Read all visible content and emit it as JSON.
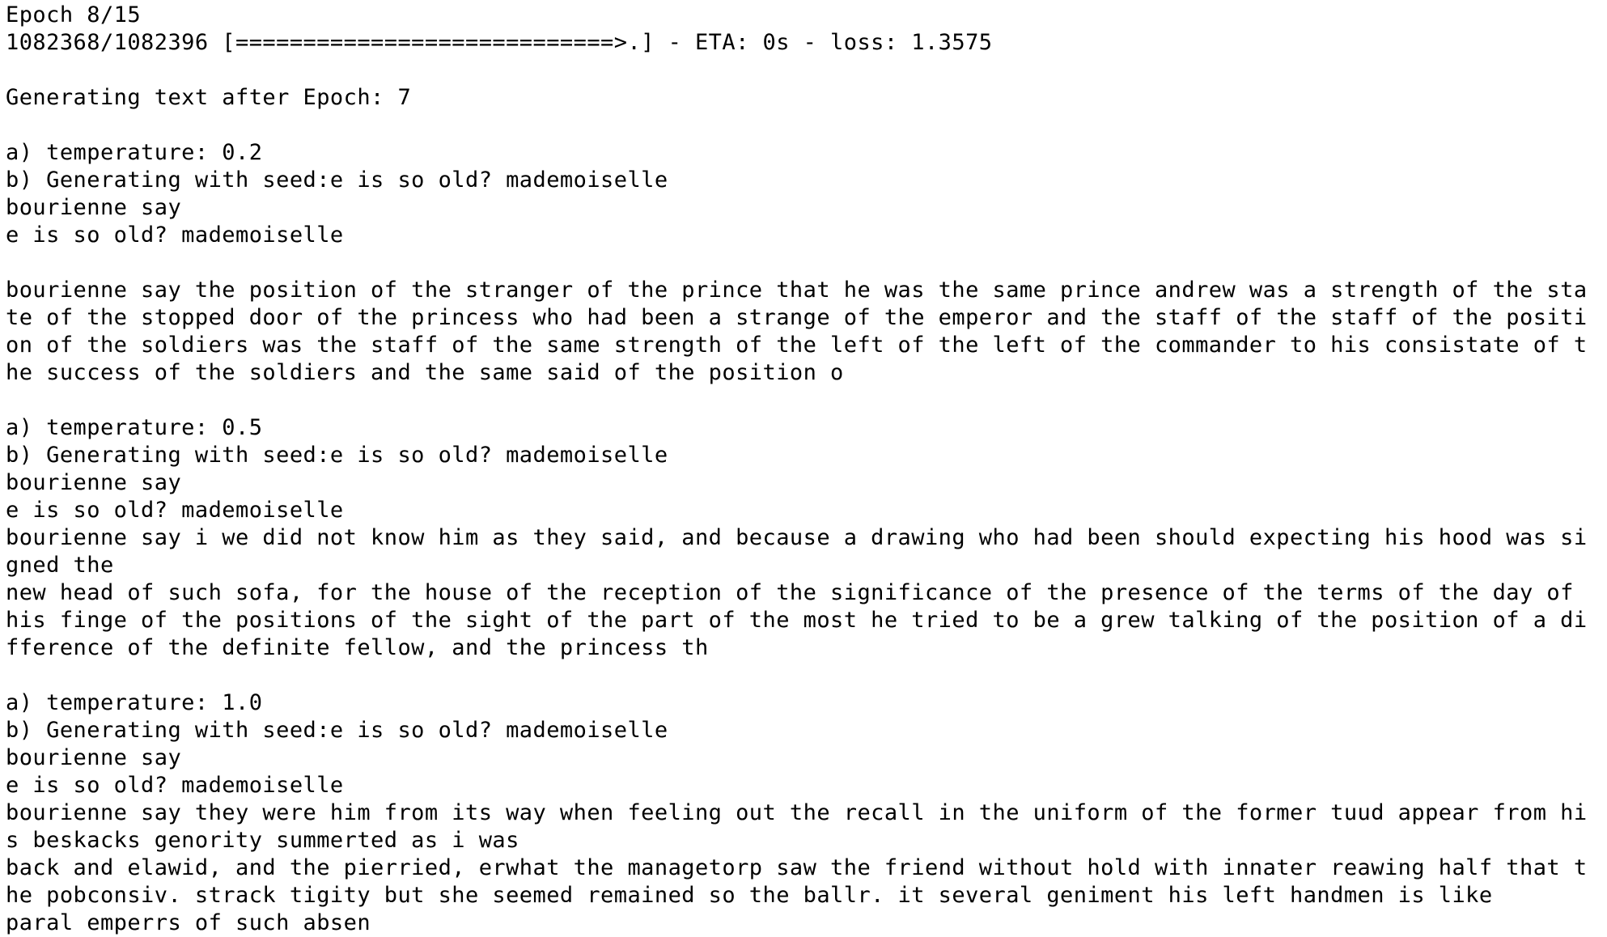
{
  "terminal": {
    "lines": [
      "Epoch 8/15",
      "1082368/1082396 [============================>.] - ETA: 0s - loss: 1.3575",
      "",
      "Generating text after Epoch: 7",
      "",
      "a) temperature: 0.2",
      "b) Generating with seed:e is so old? mademoiselle",
      "bourienne say",
      "e is so old? mademoiselle",
      "",
      "bourienne say the position of the stranger of the prince that he was the same prince andrew was a strength of the sta",
      "te of the stopped door of the princess who had been a strange of the emperor and the staff of the staff of the positi",
      "on of the soldiers was the staff of the same strength of the left of the left of the commander to his consistate of t",
      "he success of the soldiers and the same said of the position o",
      "",
      "a) temperature: 0.5",
      "b) Generating with seed:e is so old? mademoiselle",
      "bourienne say",
      "e is so old? mademoiselle",
      "bourienne say i we did not know him as they said, and because a drawing who had been should expecting his hood was si",
      "gned the",
      "new head of such sofa, for the house of the reception of the significance of the presence of the terms of the day of",
      "his finge of the positions of the sight of the part of the most he tried to be a grew talking of the position of a di",
      "fference of the definite fellow, and the princess th",
      "",
      "a) temperature: 1.0",
      "b) Generating with seed:e is so old? mademoiselle",
      "bourienne say",
      "e is so old? mademoiselle",
      "bourienne say they were him from its way when feeling out the recall in the uniform of the former tuud appear from hi",
      "s beskacks genority summerted as i was",
      "back and elawid, and the pierried, erwhat the managetorp saw the friend without hold with innater reawing half that t",
      "he pobconsiv. strack tigity but she seemed remained so the ballr. it several geniment his left handmen is like",
      "paral emperrs of such absen"
    ]
  }
}
